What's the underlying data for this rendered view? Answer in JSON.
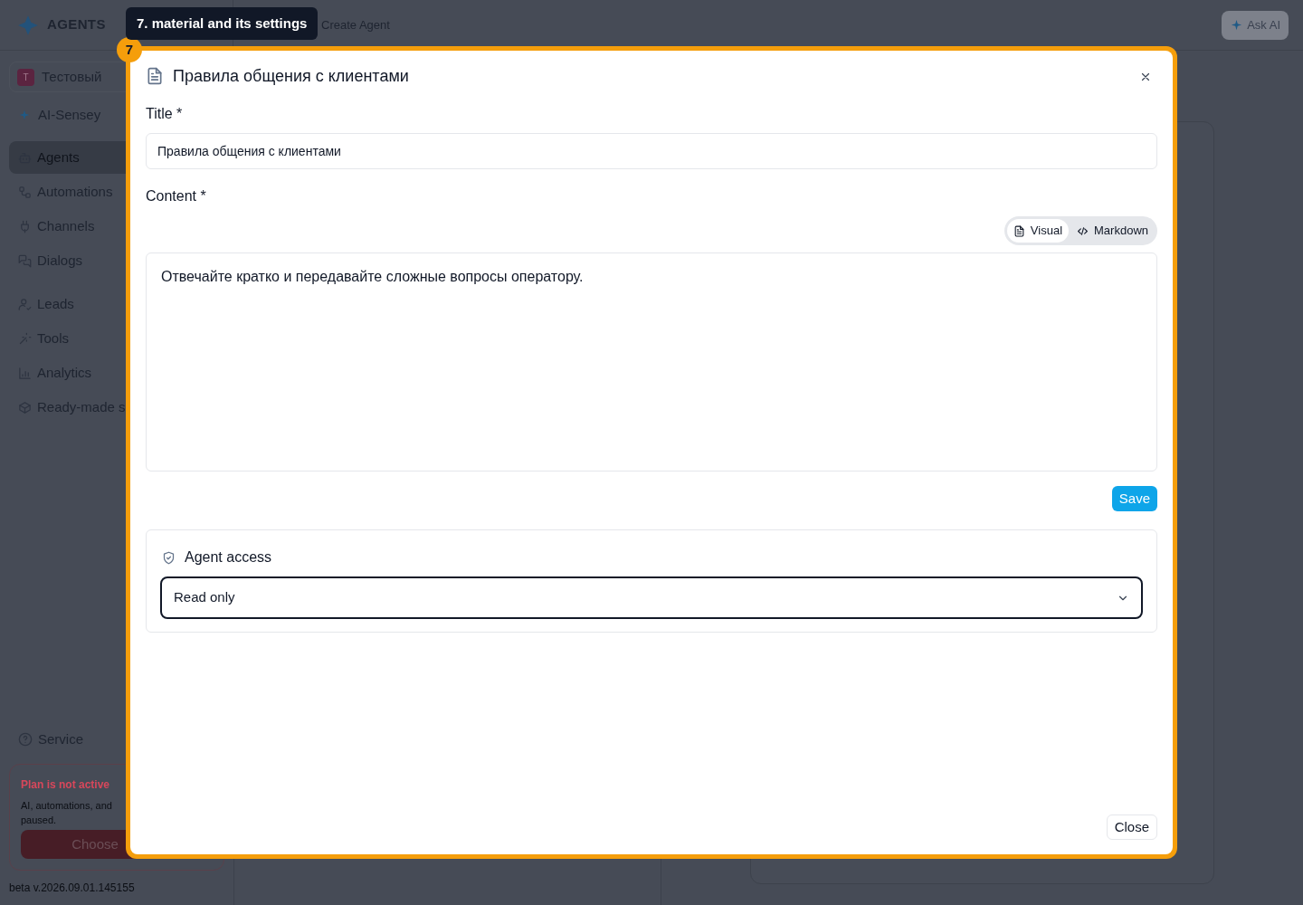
{
  "header": {
    "logo": "AGENTS",
    "breadcrumb": "Create Agent",
    "ask_ai": "Ask AI"
  },
  "sidebar": {
    "workspace": {
      "initial": "Т",
      "name": "Тестовый"
    },
    "assistant": "AI-Sensey",
    "items": [
      {
        "label": "Agents",
        "selected": true
      },
      {
        "label": "Automations",
        "selected": false
      },
      {
        "label": "Channels",
        "selected": false
      },
      {
        "label": "Dialogs",
        "selected": false
      },
      {
        "label": "Leads",
        "selected": false
      },
      {
        "label": "Tools",
        "selected": false
      },
      {
        "label": "Analytics",
        "selected": false
      },
      {
        "label": "Ready-made s",
        "selected": false
      }
    ],
    "service": "Service",
    "plan": {
      "title": "Plan is not active",
      "text": "AI, automations, and",
      "text_2": "paused.",
      "button": "Choose"
    },
    "version": "beta v.2026.09.01.145155"
  },
  "tour": {
    "step": "7",
    "tooltip": "7. material and its settings"
  },
  "modal": {
    "title": "Правила общения с клиентами",
    "title_label": "Title *",
    "title_value": "Правила общения с клиентами",
    "content_label": "Content *",
    "modes": [
      {
        "label": "Visual",
        "selected": true
      },
      {
        "label": "Markdown",
        "selected": false
      }
    ],
    "content": "Отвечайте кратко и передавайте сложные вопросы оператору.",
    "save": "Save",
    "access": {
      "title": "Agent access",
      "value": "Read only"
    },
    "close": "Close"
  }
}
